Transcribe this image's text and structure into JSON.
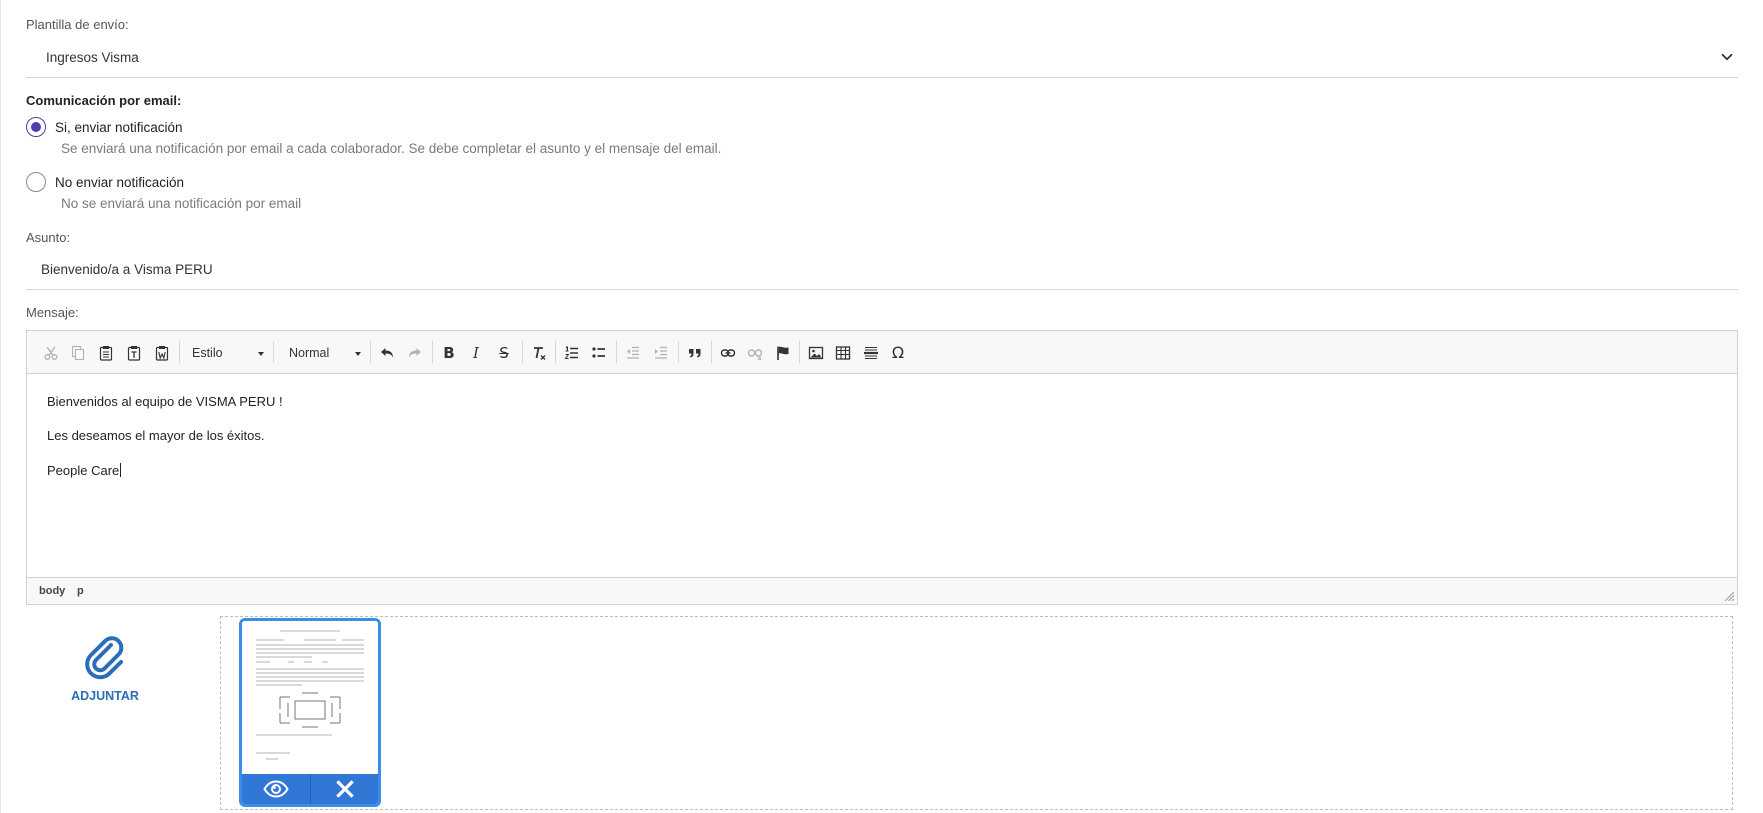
{
  "template": {
    "label": "Plantilla de envío:",
    "selected": "Ingresos Visma"
  },
  "email_communication": {
    "title": "Comunicación por email:",
    "options": [
      {
        "label": "Si, enviar notificación",
        "description": "Se enviará una notificación por email a cada colaborador. Se debe completar el asunto y el mensaje del email.",
        "checked": true
      },
      {
        "label": "No enviar notificación",
        "description": "No se enviará una notificación por email",
        "checked": false
      }
    ]
  },
  "subject": {
    "label": "Asunto:",
    "value": "Bienvenido/a a Visma PERU"
  },
  "message": {
    "label": "Mensaje:",
    "toolbar": {
      "style_combo": "Estilo",
      "format_combo": "Normal",
      "icons": [
        "cut-icon",
        "copy-icon",
        "paste-icon",
        "paste-text-icon",
        "paste-word-icon",
        "undo-icon",
        "redo-icon",
        "bold-icon",
        "italic-icon",
        "strikethrough-icon",
        "remove-format-icon",
        "numbered-list-icon",
        "bulleted-list-icon",
        "outdent-icon",
        "indent-icon",
        "blockquote-icon",
        "link-icon",
        "unlink-icon",
        "anchor-icon",
        "image-icon",
        "table-icon",
        "horizontal-rule-icon",
        "special-char-icon"
      ]
    },
    "paragraphs": [
      "Bienvenidos al equipo de VISMA PERU !",
      "Les deseamos el mayor de los éxitos.",
      "People Care"
    ],
    "path": [
      "body",
      "p"
    ]
  },
  "attachments": {
    "button_label": "ADJUNTAR",
    "files": [
      {
        "actions": [
          "eye-icon",
          "close-icon"
        ]
      }
    ]
  },
  "colors": {
    "accent": "#4b3fb0",
    "link": "#2a6eb8",
    "thumb_border": "#3b8ee8",
    "thumb_actions": "#3178d6"
  }
}
